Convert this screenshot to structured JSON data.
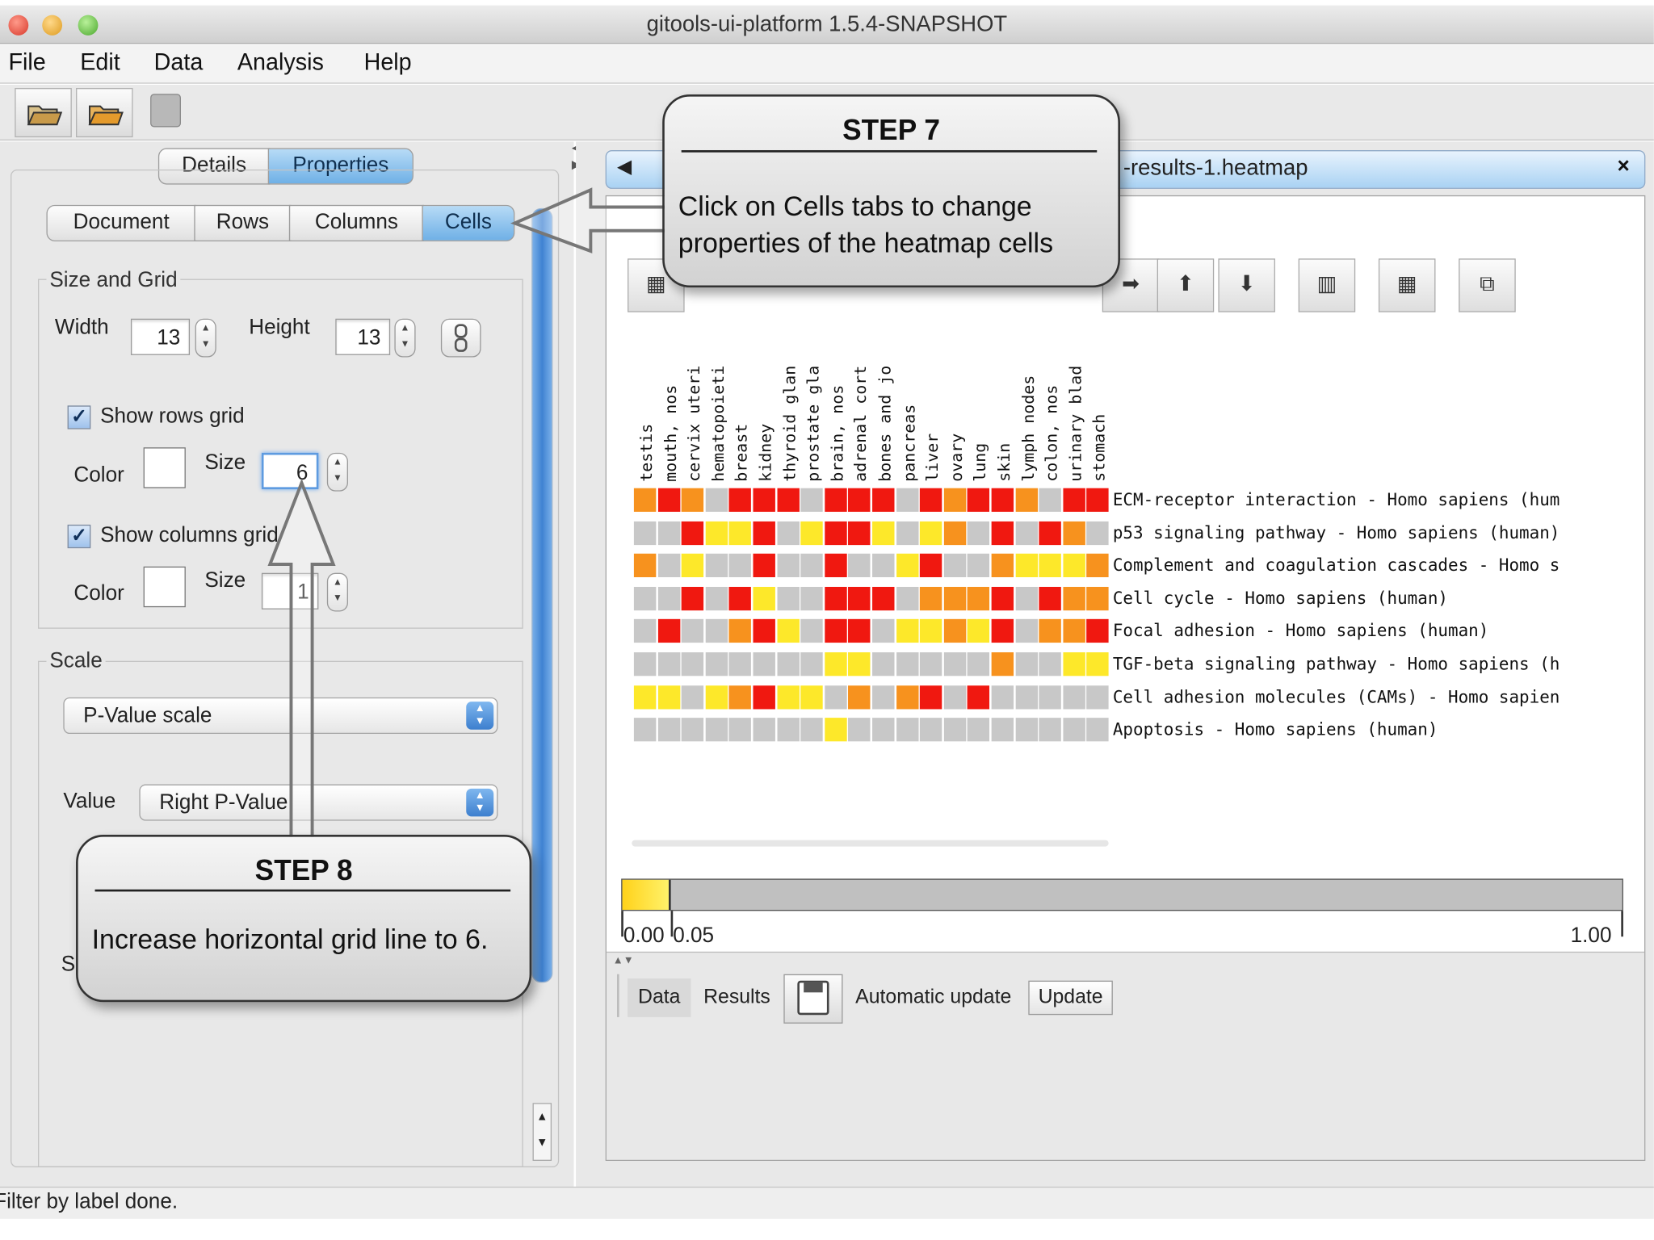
{
  "window": {
    "title": "gitools-ui-platform 1.5.4-SNAPSHOT"
  },
  "menubar": [
    "File",
    "Edit",
    "Data",
    "Analysis",
    "Help"
  ],
  "toolbar": {
    "buttons": [
      "open-folder-icon",
      "open-file-icon",
      "save-icon"
    ]
  },
  "left_panel": {
    "top_tabs": [
      "Details",
      "Properties"
    ],
    "sub_tabs": [
      "Document",
      "Rows",
      "Columns",
      "Cells"
    ],
    "size_and_grid": {
      "title": "Size and Grid",
      "width_label": "Width",
      "width_value": "13",
      "height_label": "Height",
      "height_value": "13",
      "show_rows_grid": "Show rows grid",
      "rows_color_label": "Color",
      "rows_size_label": "Size",
      "rows_size_value": "6",
      "show_columns_grid": "Show columns grid",
      "cols_color_label": "Color",
      "cols_size_label": "Size",
      "cols_size_value": "1"
    },
    "scale": {
      "title": "Scale",
      "scale_select": "P-Value scale",
      "value_label": "Value",
      "value_select": "Right P-Value",
      "hidden_label": "S"
    }
  },
  "editor": {
    "tab_title": "-results-1.heatmap",
    "close": "×",
    "nav_left": "◀",
    "columns": [
      "testis",
      "mouth, nos",
      "cervix uteri",
      "hematopoieti",
      "breast",
      "kidney",
      "thyroid glan",
      "prostate gla",
      "brain, nos",
      "adrenal cort",
      "bones and jo",
      "pancreas",
      "liver",
      "ovary",
      "lung",
      "skin",
      "lymph nodes",
      "colon, nos",
      "urinary blad",
      "stomach"
    ],
    "rows": [
      "ECM-receptor interaction - Homo sapiens (hum",
      "p53 signaling pathway - Homo sapiens (human)",
      "Complement and coagulation cascades - Homo s",
      "Cell cycle - Homo sapiens (human)",
      "Focal adhesion - Homo sapiens (human)",
      "TGF-beta signaling pathway - Homo sapiens (h",
      "Cell adhesion molecules (CAMs) - Homo sapien",
      "Apoptosis - Homo sapiens (human)"
    ],
    "cells": [
      "OROGRRRGRRRGRORROGRR",
      "GGRYYRGYRRYGYOGRGROG",
      "OGYGGRGGRGGYRGGOYYYO",
      "GGRGRYGGRRRGOOORGROO",
      "GRGGORYGRRGYYOYRGOOR",
      "GGGGGGGGYYGGGGGOGGYY",
      "YYGYORYYGOGORGRGGGGG",
      "GGGGGGGGYGGGGGGGGGGG"
    ],
    "colors": {
      "R": "#f01810",
      "O": "#f7921e",
      "Y": "#fde82a",
      "G": "#c8c8c8"
    },
    "legend": {
      "min": "0.00",
      "mid": "0.05",
      "max": "1.00"
    },
    "bottom": {
      "data_tab": "Data",
      "results_tab": "Results",
      "auto_update": "Automatic update",
      "update_btn": "Update"
    }
  },
  "callouts": {
    "step7_title": "STEP 7",
    "step7_line1": "Click on Cells tabs to change",
    "step7_line2": "properties of the heatmap cells",
    "step8_title": "STEP 8",
    "step8_text": "Increase horizontal grid line to 6."
  },
  "status": {
    "text": "Filter by label done."
  }
}
